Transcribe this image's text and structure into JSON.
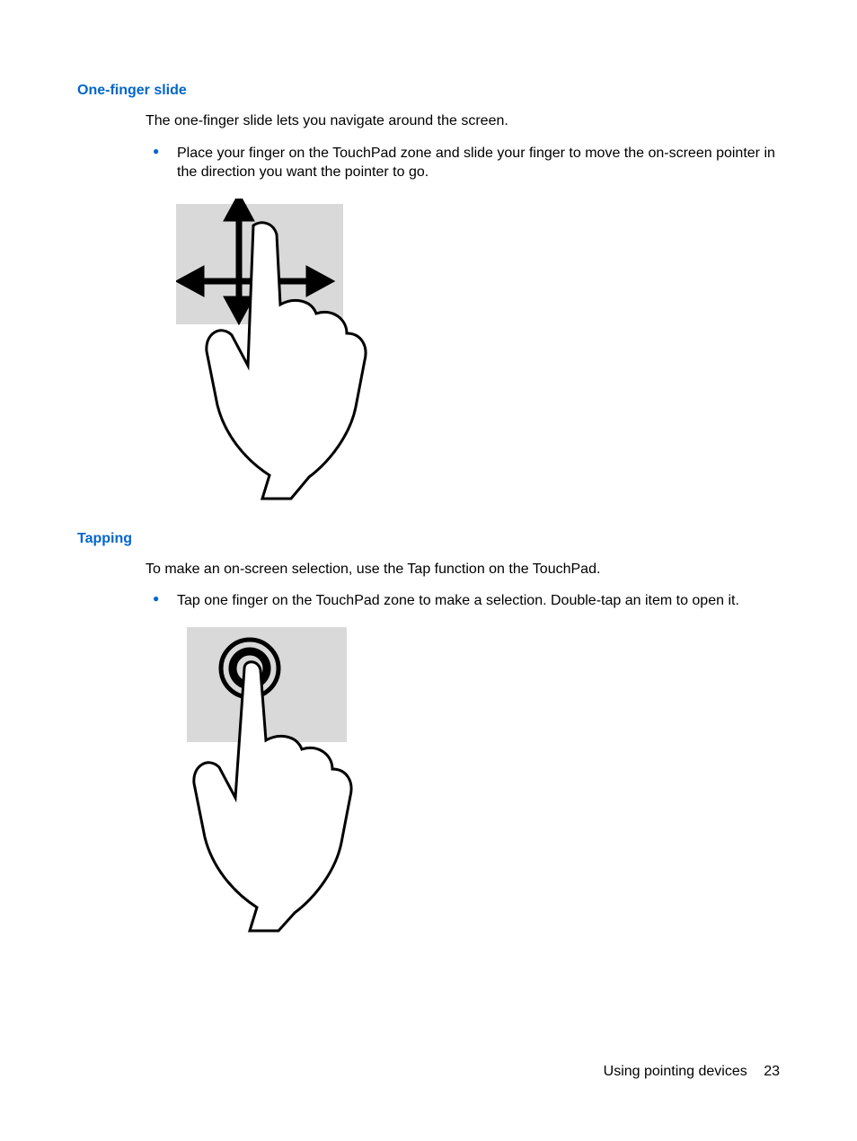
{
  "section1": {
    "heading": "One-finger slide",
    "intro": "The one-finger slide lets you navigate around the screen.",
    "bullet": "Place your finger on the TouchPad zone and slide your finger to move the on-screen pointer in the direction you want the pointer to go."
  },
  "section2": {
    "heading": "Tapping",
    "intro": "To make an on-screen selection, use the Tap function on the TouchPad.",
    "bullet": "Tap one finger on the TouchPad zone to make a selection. Double-tap an item to open it."
  },
  "footer": {
    "label": "Using pointing devices",
    "page": "23"
  }
}
